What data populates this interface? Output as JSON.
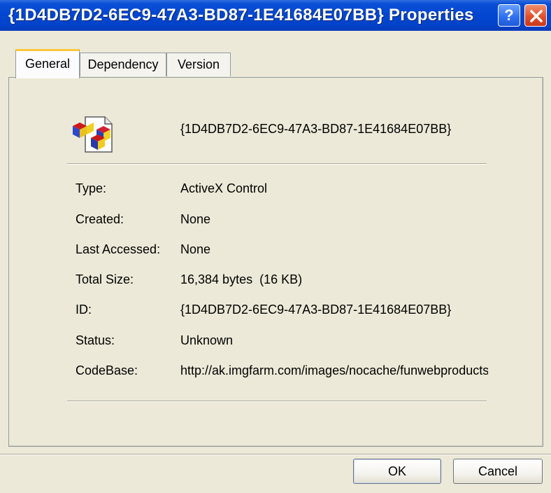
{
  "window": {
    "title": "{1D4DB7D2-6EC9-47A3-BD87-1E41684E07BB} Properties",
    "help_label": "?",
    "title_bar_color": "#0246d0",
    "close_button_color": "#e0502a"
  },
  "tabs": [
    {
      "label": "General",
      "active": true
    },
    {
      "label": "Dependency",
      "active": false
    },
    {
      "label": "Version",
      "active": false
    }
  ],
  "general": {
    "icon": "activex-control-file-icon",
    "name": "{1D4DB7D2-6EC9-47A3-BD87-1E41684E07BB}",
    "rows": [
      {
        "label": "Type:",
        "value": "ActiveX Control"
      },
      {
        "label": "Created:",
        "value": "None"
      },
      {
        "label": "Last Accessed:",
        "value": "None"
      },
      {
        "label": "Total Size:",
        "value": "16,384 bytes  (16 KB)"
      },
      {
        "label": "ID:",
        "value": "{1D4DB7D2-6EC9-47A3-BD87-1E41684E07BB}"
      },
      {
        "label": "Status:",
        "value": "Unknown"
      },
      {
        "label": "CodeBase:",
        "value": "http://ak.imgfarm.com/images/nocache/funwebproducts"
      }
    ]
  },
  "buttons": {
    "ok_label": "OK",
    "cancel_label": "Cancel"
  }
}
